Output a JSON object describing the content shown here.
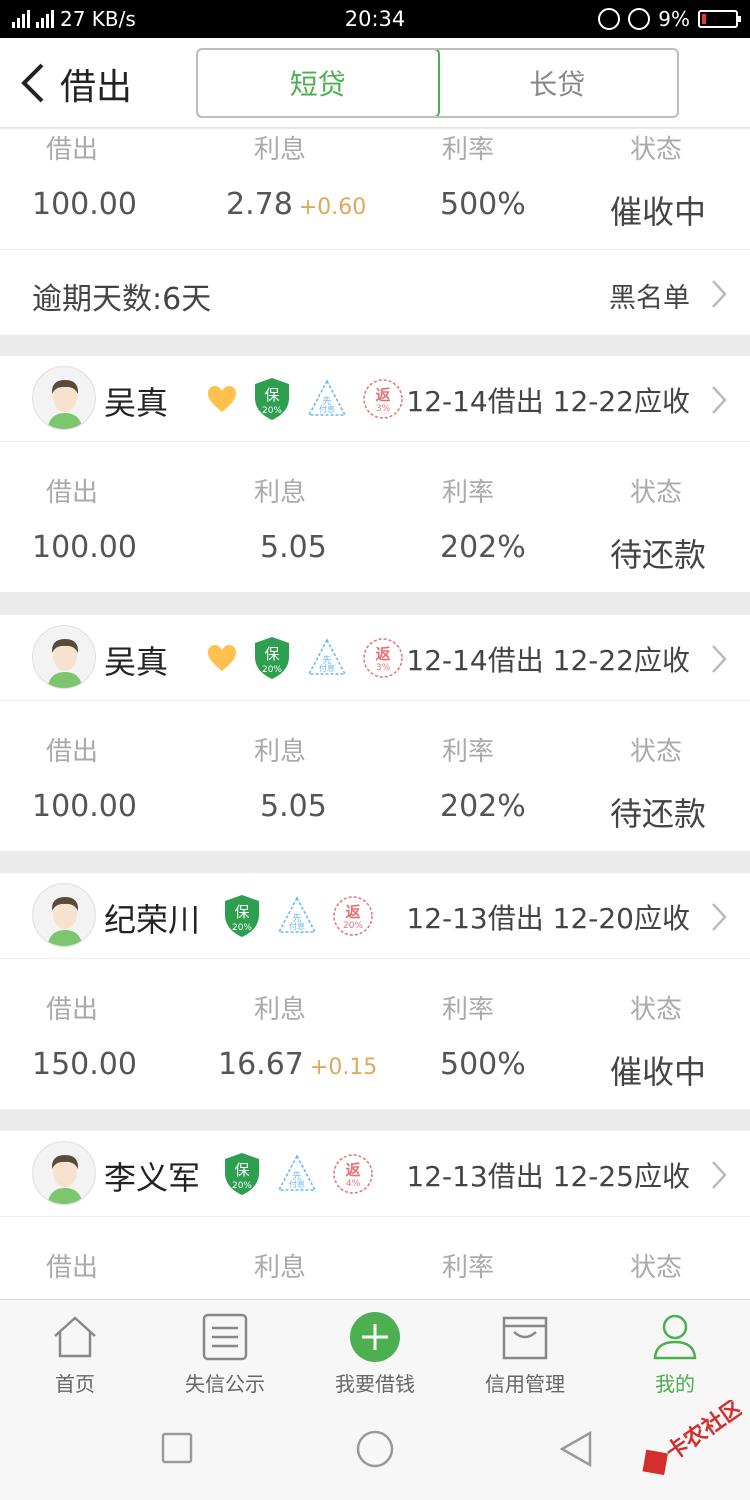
{
  "status_bar": {
    "network": "3G 4G",
    "speed": "27 KB/s",
    "time": "20:34",
    "battery": "9%"
  },
  "header": {
    "back_label": "借出",
    "tabs": [
      {
        "label": "短贷",
        "active": true
      },
      {
        "label": "长贷",
        "active": false
      }
    ]
  },
  "labels": {
    "lend": "借出",
    "interest": "利息",
    "rate": "利率",
    "status": "状态"
  },
  "top_partial": {
    "lend": "100.00",
    "interest": "2.78",
    "interest_extra": "+0.60",
    "rate": "500%",
    "status": "催收中",
    "overdue": "逾期天数:6天",
    "blacklist": "黑名单"
  },
  "records": [
    {
      "name": "吴真",
      "heart": true,
      "guarantee": "保",
      "guarantee_pct": "20%",
      "prepay": "先付息",
      "rebate": "返",
      "rebate_pct": "3%",
      "dates": "12-14借出 12-22应收",
      "lend": "100.00",
      "interest": "5.05",
      "interest_extra": "",
      "rate": "202%",
      "status": "待还款"
    },
    {
      "name": "吴真",
      "heart": true,
      "guarantee": "保",
      "guarantee_pct": "20%",
      "prepay": "先付息",
      "rebate": "返",
      "rebate_pct": "3%",
      "dates": "12-14借出 12-22应收",
      "lend": "100.00",
      "interest": "5.05",
      "interest_extra": "",
      "rate": "202%",
      "status": "待还款"
    },
    {
      "name": "纪荣川",
      "heart": false,
      "guarantee": "保",
      "guarantee_pct": "20%",
      "prepay": "先付息",
      "rebate": "返",
      "rebate_pct": "20%",
      "dates": "12-13借出 12-20应收",
      "lend": "150.00",
      "interest": "16.67",
      "interest_extra": "+0.15",
      "rate": "500%",
      "status": "催收中"
    },
    {
      "name": "李义军",
      "heart": false,
      "guarantee": "保",
      "guarantee_pct": "20%",
      "prepay": "先付息",
      "rebate": "返",
      "rebate_pct": "4%",
      "dates": "12-13借出 12-25应收",
      "lend": "",
      "interest": "",
      "interest_extra": "",
      "rate": "",
      "status": ""
    }
  ],
  "tabbar": [
    {
      "label": "首页",
      "icon": "home-icon"
    },
    {
      "label": "失信公示",
      "icon": "list-icon"
    },
    {
      "label": "我要借钱",
      "icon": "plus-circle-icon"
    },
    {
      "label": "信用管理",
      "icon": "box-icon"
    },
    {
      "label": "我的",
      "icon": "user-icon",
      "active": true
    }
  ],
  "watermark": "卡农社区",
  "colors": {
    "accent": "#4caf50",
    "interest_extra": "#e0a85a",
    "rebate": "#e57373",
    "prepay": "#64b5f6",
    "heart": "#ffc04d"
  }
}
